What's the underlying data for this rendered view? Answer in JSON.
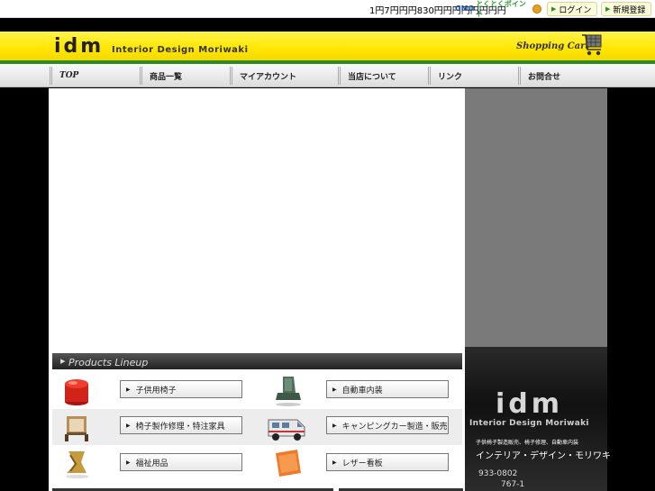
{
  "topbar": {
    "notice": "1円7円円円830円円円円円円円円",
    "gmo_a": "GMO",
    "gmo_b": "とくとくポイント",
    "login": "ログイン",
    "register": "新規登録"
  },
  "header": {
    "logo_mark": "idm",
    "logo_text": "Interior Design Moriwaki",
    "cart_label": "Shopping Cart"
  },
  "nav": {
    "items": [
      {
        "label": "TOP"
      },
      {
        "label": "商品一覧"
      },
      {
        "label": "マイアカウント"
      },
      {
        "label": "当店について"
      },
      {
        "label": "リンク"
      },
      {
        "label": "お問合せ"
      }
    ]
  },
  "products": {
    "heading": "Products Lineup",
    "items": [
      {
        "label": "子供用椅子",
        "icon": "red-stool-icon"
      },
      {
        "label": "自動車内装",
        "icon": "car-seat-icon"
      },
      {
        "label": "椅子製作修理・特注家具",
        "icon": "chair-frame-icon"
      },
      {
        "label": "キャンピングカー製造・販売",
        "icon": "camper-van-icon"
      },
      {
        "label": "福祉用品",
        "icon": "cushion-icon"
      },
      {
        "label": "レザー看板",
        "icon": "leather-sign-icon"
      }
    ]
  },
  "sidebar": {
    "logo": "idm",
    "subtitle": "Interior Design Moriwaki",
    "description": "子供椅子製造販売、椅子修理、自動車内装",
    "company": "インテリア・デザイン・モリワキ",
    "zip": "933-0802",
    "address": "767-1"
  },
  "colors": {
    "header_yellow": "#ffe600",
    "accent_green": "#2e8b24",
    "logo_red": "#d0341e"
  }
}
